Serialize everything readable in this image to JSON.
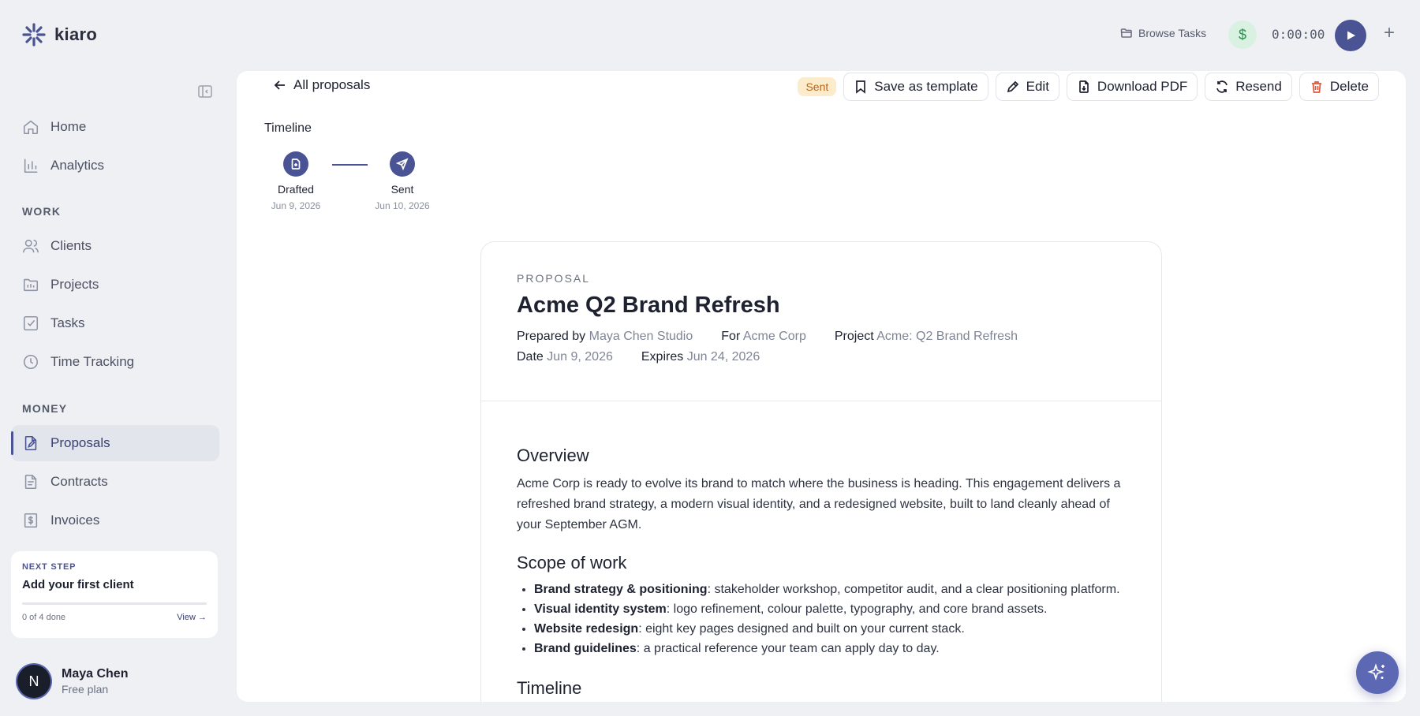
{
  "app": {
    "name": "kiaro"
  },
  "colors": {
    "accent": "#4a5494",
    "status_sent_bg": "#fdeccc",
    "status_sent_text": "#b5651d",
    "danger": "#e0573a",
    "money_green": "#2f8f52"
  },
  "sidebar": {
    "items_top": [
      {
        "label": "Home",
        "icon": "home-icon"
      },
      {
        "label": "Analytics",
        "icon": "chart-icon"
      }
    ],
    "work_label": "WORK",
    "items_work": [
      {
        "label": "Clients",
        "icon": "users-icon"
      },
      {
        "label": "Projects",
        "icon": "folder-icon"
      },
      {
        "label": "Tasks",
        "icon": "checkbox-icon"
      },
      {
        "label": "Time Tracking",
        "icon": "clock-icon"
      }
    ],
    "money_label": "MONEY",
    "items_money": [
      {
        "label": "Proposals",
        "icon": "proposal-icon",
        "active": true
      },
      {
        "label": "Contracts",
        "icon": "document-icon"
      },
      {
        "label": "Invoices",
        "icon": "invoice-icon"
      }
    ],
    "next_step": {
      "label": "NEXT STEP",
      "title": "Add your first client",
      "progress_text": "0 of 4 done",
      "progress": 0,
      "view_label": "View →"
    },
    "user": {
      "initial": "N",
      "name": "Maya Chen",
      "plan": "Free plan"
    }
  },
  "topbar": {
    "browse_label": "Browse Tasks",
    "dollar": "$",
    "timer": "0:00:00",
    "plus": "+"
  },
  "header": {
    "back_label": "All proposals",
    "status": "Sent",
    "actions": {
      "save_template": "Save as template",
      "edit": "Edit",
      "download": "Download PDF",
      "resend": "Resend",
      "delete": "Delete"
    }
  },
  "timeline": {
    "title": "Timeline",
    "steps": [
      {
        "label": "Drafted",
        "date": "Jun 9, 2026"
      },
      {
        "label": "Sent",
        "date": "Jun 10, 2026"
      }
    ]
  },
  "proposal": {
    "kicker": "PROPOSAL",
    "title": "Acme Q2 Brand Refresh",
    "meta": {
      "prepared_by_key": "Prepared by",
      "prepared_by": "Maya Chen Studio",
      "for_key": "For",
      "for": "Acme Corp",
      "project_key": "Project",
      "project": "Acme: Q2 Brand Refresh",
      "date_key": "Date",
      "date": "Jun 9, 2026",
      "expires_key": "Expires",
      "expires": "Jun 24, 2026"
    },
    "overview_heading": "Overview",
    "overview_text": "Acme Corp is ready to evolve its brand to match where the business is heading. This engagement delivers a refreshed brand strategy, a modern visual identity, and a redesigned website, built to land cleanly ahead of your September AGM.",
    "scope_heading": "Scope of work",
    "scope": [
      {
        "title": "Brand strategy & positioning",
        "text": ": stakeholder workshop, competitor audit, and a clear positioning platform."
      },
      {
        "title": "Visual identity system",
        "text": ": logo refinement, colour palette, typography, and core brand assets."
      },
      {
        "title": "Website redesign",
        "text": ": eight key pages designed and built on your current stack."
      },
      {
        "title": "Brand guidelines",
        "text": ": a practical reference your team can apply day to day."
      }
    ],
    "timeline_heading": "Timeline"
  }
}
